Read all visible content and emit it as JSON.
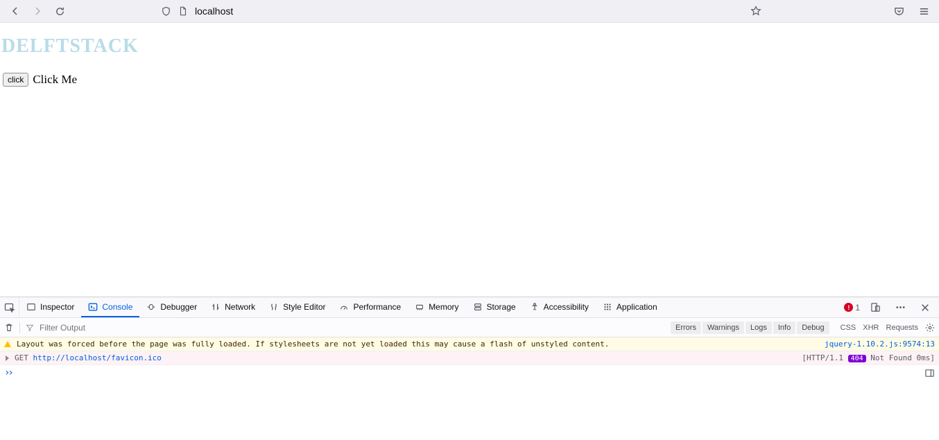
{
  "browser": {
    "url": "localhost"
  },
  "page": {
    "heading": "DELFTSTACK",
    "button": "click",
    "button_label": "Click Me"
  },
  "devtools": {
    "tabs": {
      "inspector": "Inspector",
      "console": "Console",
      "debugger": "Debugger",
      "network": "Network",
      "style": "Style Editor",
      "performance": "Performance",
      "memory": "Memory",
      "storage": "Storage",
      "accessibility": "Accessibility",
      "application": "Application"
    },
    "error_count": "1",
    "filter_placeholder": "Filter Output",
    "chips": {
      "errors": "Errors",
      "warnings": "Warnings",
      "logs": "Logs",
      "info": "Info",
      "debug": "Debug"
    },
    "opts": {
      "css": "CSS",
      "xhr": "XHR",
      "requests": "Requests"
    },
    "logs": {
      "warn_msg": "Layout was forced before the page was fully loaded. If stylesheets are not yet loaded this may cause a flash of unstyled content.",
      "warn_src": "jquery-1.10.2.js:9574:13",
      "err_get": "GET",
      "err_url": "http://localhost/favicon.ico",
      "err_proto": "[HTTP/1.1",
      "err_code": "404",
      "err_status": "Not Found 0ms]"
    }
  }
}
